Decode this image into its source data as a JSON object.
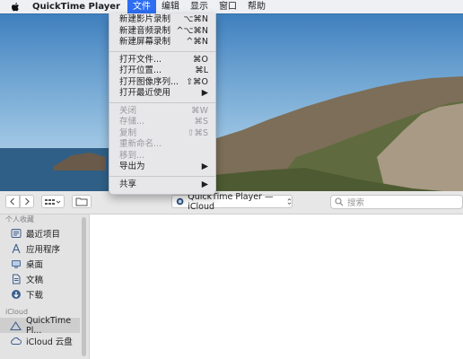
{
  "menubar": {
    "app_name": "QuickTime Player",
    "menus": [
      "文件",
      "编辑",
      "显示",
      "窗口",
      "帮助"
    ],
    "active_menu": "文件"
  },
  "file_menu": {
    "group1": [
      {
        "label": "新建影片录制",
        "shortcut": "⌥⌘N"
      },
      {
        "label": "新建音频录制",
        "shortcut": "^⌥⌘N"
      },
      {
        "label": "新建屏幕录制",
        "shortcut": "^⌘N"
      }
    ],
    "group2": [
      {
        "label": "打开文件...",
        "shortcut": "⌘O"
      },
      {
        "label": "打开位置...",
        "shortcut": "⌘L"
      },
      {
        "label": "打开图像序列...",
        "shortcut": "⇧⌘O"
      },
      {
        "label": "打开最近使用",
        "shortcut": "▶"
      }
    ],
    "group3": [
      {
        "label": "关闭",
        "shortcut": "⌘W"
      },
      {
        "label": "存储...",
        "shortcut": "⌘S"
      },
      {
        "label": "复制",
        "shortcut": "⇧⌘S"
      },
      {
        "label": "重新命名...",
        "shortcut": ""
      },
      {
        "label": "移到...",
        "shortcut": ""
      },
      {
        "label": "导出为",
        "shortcut": "▶"
      }
    ],
    "group4": [
      {
        "label": "共享",
        "shortcut": "▶"
      }
    ]
  },
  "toolbar": {
    "location": "QuickTime Player — iCloud",
    "search_placeholder": "搜索"
  },
  "sidebar": {
    "favorites_header": "个人收藏",
    "favorites": [
      {
        "label": "最近项目",
        "icon": "clock-icon"
      },
      {
        "label": "应用程序",
        "icon": "applications-icon"
      },
      {
        "label": "桌面",
        "icon": "desktop-icon"
      },
      {
        "label": "文稿",
        "icon": "document-icon"
      },
      {
        "label": "下载",
        "icon": "download-icon"
      }
    ],
    "icloud_header": "iCloud",
    "icloud": [
      {
        "label": "QuickTime Pl...",
        "icon": "quicktime-icon",
        "selected": true
      },
      {
        "label": "iCloud 云盘",
        "icon": "cloud-icon",
        "selected": false
      }
    ]
  }
}
